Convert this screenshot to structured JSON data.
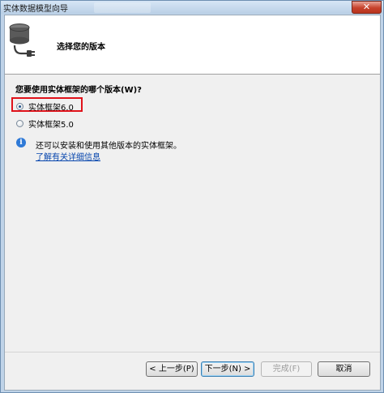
{
  "window": {
    "title": "实体数据模型向导",
    "close_label": "✕"
  },
  "header": {
    "title": "选择您的版本"
  },
  "question": "您要使用实体框架的哪个版本(W)?",
  "options": [
    {
      "label": "实体框架6.0",
      "selected": true
    },
    {
      "label": "实体框架5.0",
      "selected": false
    }
  ],
  "info": {
    "text": "还可以安装和使用其他版本的实体框架。",
    "link": "了解有关详细信息",
    "icon": "info-icon"
  },
  "buttons": {
    "back": "< 上一步(P)",
    "next": "下一步(N) >",
    "finish": "完成(F)",
    "cancel": "取消"
  },
  "colors": {
    "highlight": "#e0121a",
    "link": "#0645ad",
    "info": "#2f7ad7"
  }
}
